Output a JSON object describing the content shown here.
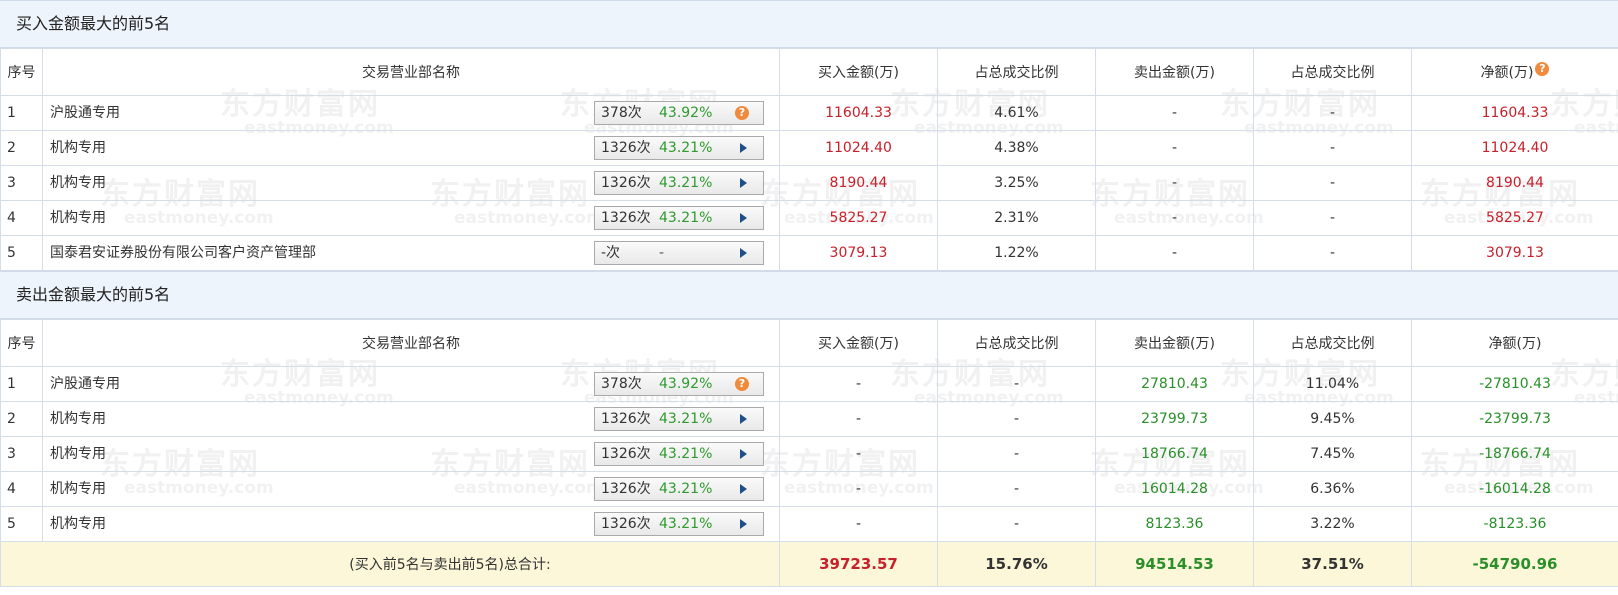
{
  "watermark": {
    "cn": "东方财富网",
    "en": "eastmoney.com"
  },
  "columns": {
    "idx": "序号",
    "name": "交易营业部名称",
    "buy_amount": "买入金额(万)",
    "buy_ratio": "占总成交比例",
    "sell_amount": "卖出金额(万)",
    "sell_ratio": "占总成交比例",
    "net": "净额(万)"
  },
  "buy_section": {
    "title": "买入金额最大的前5名",
    "rows": [
      {
        "idx": "1",
        "name": "沪股通专用",
        "count": "378次",
        "pct": "43.92%",
        "icon": "question-icon",
        "buy": "11604.33",
        "buy_ratio": "4.61%",
        "sell": "-",
        "sell_ratio": "-",
        "net": "11604.33"
      },
      {
        "idx": "2",
        "name": "机构专用",
        "count": "1326次",
        "pct": "43.21%",
        "icon": "arrow-right-icon",
        "buy": "11024.40",
        "buy_ratio": "4.38%",
        "sell": "-",
        "sell_ratio": "-",
        "net": "11024.40"
      },
      {
        "idx": "3",
        "name": "机构专用",
        "count": "1326次",
        "pct": "43.21%",
        "icon": "arrow-right-icon",
        "buy": "8190.44",
        "buy_ratio": "3.25%",
        "sell": "-",
        "sell_ratio": "-",
        "net": "8190.44"
      },
      {
        "idx": "4",
        "name": "机构专用",
        "count": "1326次",
        "pct": "43.21%",
        "icon": "arrow-right-icon",
        "buy": "5825.27",
        "buy_ratio": "2.31%",
        "sell": "-",
        "sell_ratio": "-",
        "net": "5825.27"
      },
      {
        "idx": "5",
        "name": "国泰君安证券股份有限公司客户资产管理部",
        "count": "-次",
        "pct": "-",
        "icon": "arrow-right-icon",
        "buy": "3079.13",
        "buy_ratio": "1.22%",
        "sell": "-",
        "sell_ratio": "-",
        "net": "3079.13"
      }
    ]
  },
  "sell_section": {
    "title": "卖出金额最大的前5名",
    "rows": [
      {
        "idx": "1",
        "name": "沪股通专用",
        "count": "378次",
        "pct": "43.92%",
        "icon": "question-icon",
        "buy": "-",
        "buy_ratio": "-",
        "sell": "27810.43",
        "sell_ratio": "11.04%",
        "net": "-27810.43"
      },
      {
        "idx": "2",
        "name": "机构专用",
        "count": "1326次",
        "pct": "43.21%",
        "icon": "arrow-right-icon",
        "buy": "-",
        "buy_ratio": "-",
        "sell": "23799.73",
        "sell_ratio": "9.45%",
        "net": "-23799.73"
      },
      {
        "idx": "3",
        "name": "机构专用",
        "count": "1326次",
        "pct": "43.21%",
        "icon": "arrow-right-icon",
        "buy": "-",
        "buy_ratio": "-",
        "sell": "18766.74",
        "sell_ratio": "7.45%",
        "net": "-18766.74"
      },
      {
        "idx": "4",
        "name": "机构专用",
        "count": "1326次",
        "pct": "43.21%",
        "icon": "arrow-right-icon",
        "buy": "-",
        "buy_ratio": "-",
        "sell": "16014.28",
        "sell_ratio": "6.36%",
        "net": "-16014.28"
      },
      {
        "idx": "5",
        "name": "机构专用",
        "count": "1326次",
        "pct": "43.21%",
        "icon": "arrow-right-icon",
        "buy": "-",
        "buy_ratio": "-",
        "sell": "8123.36",
        "sell_ratio": "3.22%",
        "net": "-8123.36"
      }
    ]
  },
  "total": {
    "label": "(买入前5名与卖出前5名)总合计:",
    "buy": "39723.57",
    "buy_ratio": "15.76%",
    "sell": "94514.53",
    "sell_ratio": "37.51%",
    "net": "-54790.96"
  },
  "colors": {
    "buy": "#c8202a",
    "sell": "#2a8f2a",
    "header_bg": "#eef4fb",
    "total_bg": "#fcf7d9"
  }
}
